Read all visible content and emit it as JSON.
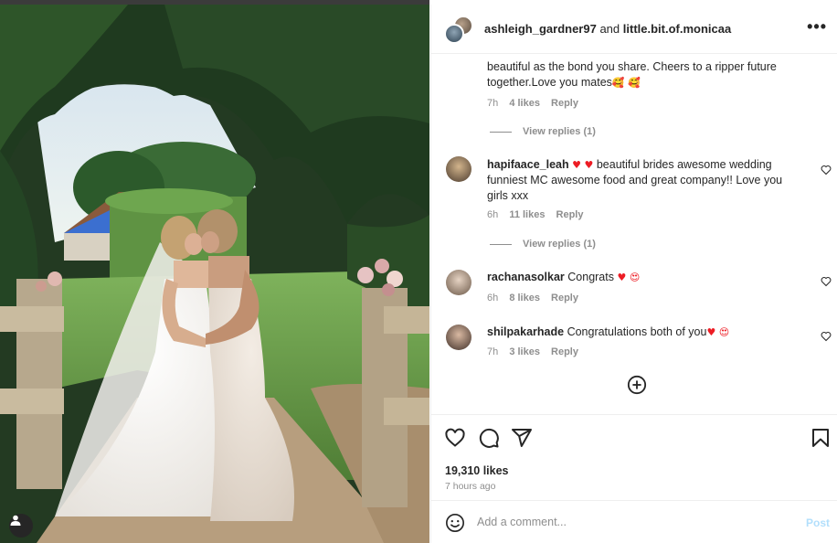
{
  "header": {
    "user1": "ashleigh_gardner97",
    "conj": "and",
    "user2": "little.bit.of.monicaa",
    "more_label": "•••"
  },
  "comments": [
    {
      "text_partial": "beautiful as the bond you share. Cheers to a ripper future together.Love you mates",
      "emoji_suffix": "🥰 🥰",
      "time": "7h",
      "likes": "4 likes",
      "reply": "Reply",
      "view_replies": "View replies (1)"
    },
    {
      "username": "hapifaace_leah",
      "hearts": "♥ ♥",
      "text": "beautiful brides awesome wedding funniest MC awesome food and great company!! Love you girls xxx",
      "time": "6h",
      "likes": "11 likes",
      "reply": "Reply",
      "view_replies": "View replies (1)"
    },
    {
      "username": "rachanasolkar",
      "text": "Congrats",
      "emoji_suffix": "♥ 😍",
      "time": "6h",
      "likes": "8 likes",
      "reply": "Reply"
    },
    {
      "username": "shilpakarhade",
      "text": "Congratulations both of you",
      "emoji_suffix": "♥ 😍",
      "time": "7h",
      "likes": "3 likes",
      "reply": "Reply"
    }
  ],
  "footer": {
    "likes": "19,310 likes",
    "time_ago": "7 hours ago",
    "comment_placeholder": "Add a comment...",
    "post_label": "Post"
  },
  "icons": {
    "header_more": "more-options-icon",
    "like": "heart-icon",
    "comment": "comment-icon",
    "share": "share-icon",
    "save": "bookmark-icon",
    "emoji": "emoji-icon",
    "load_more": "plus-circle-icon",
    "tag": "user-tag-icon"
  },
  "colors": {
    "muted": "#8e8e8e",
    "text": "#262626",
    "post_disabled": "#b2dffc",
    "heart_red": "#ed1c24"
  }
}
